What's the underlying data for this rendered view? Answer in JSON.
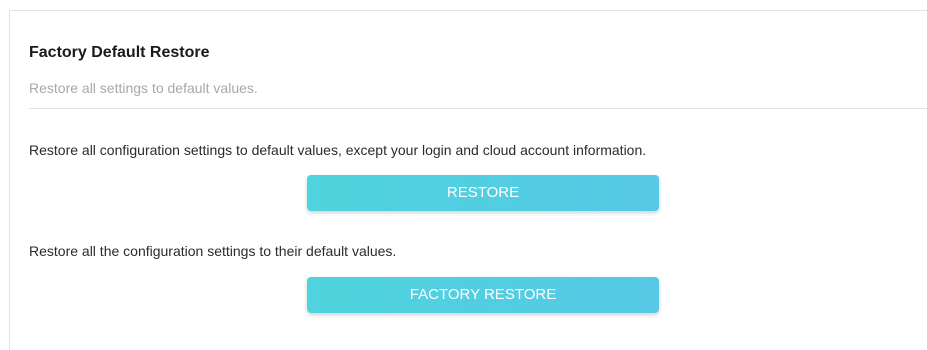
{
  "section": {
    "title": "Factory Default Restore",
    "subtitle": "Restore all settings to default values."
  },
  "restore": {
    "description": "Restore all configuration settings to default values, except your login and cloud account information.",
    "button_label": "RESTORE"
  },
  "factory_restore": {
    "description": "Restore all the configuration settings to their default values.",
    "button_label": "FACTORY RESTORE"
  },
  "colors": {
    "button_start": "#4fd3dc",
    "button_end": "#56c9e6",
    "title_text": "#1a1a1a",
    "subtitle_text": "#a8a8a8"
  }
}
